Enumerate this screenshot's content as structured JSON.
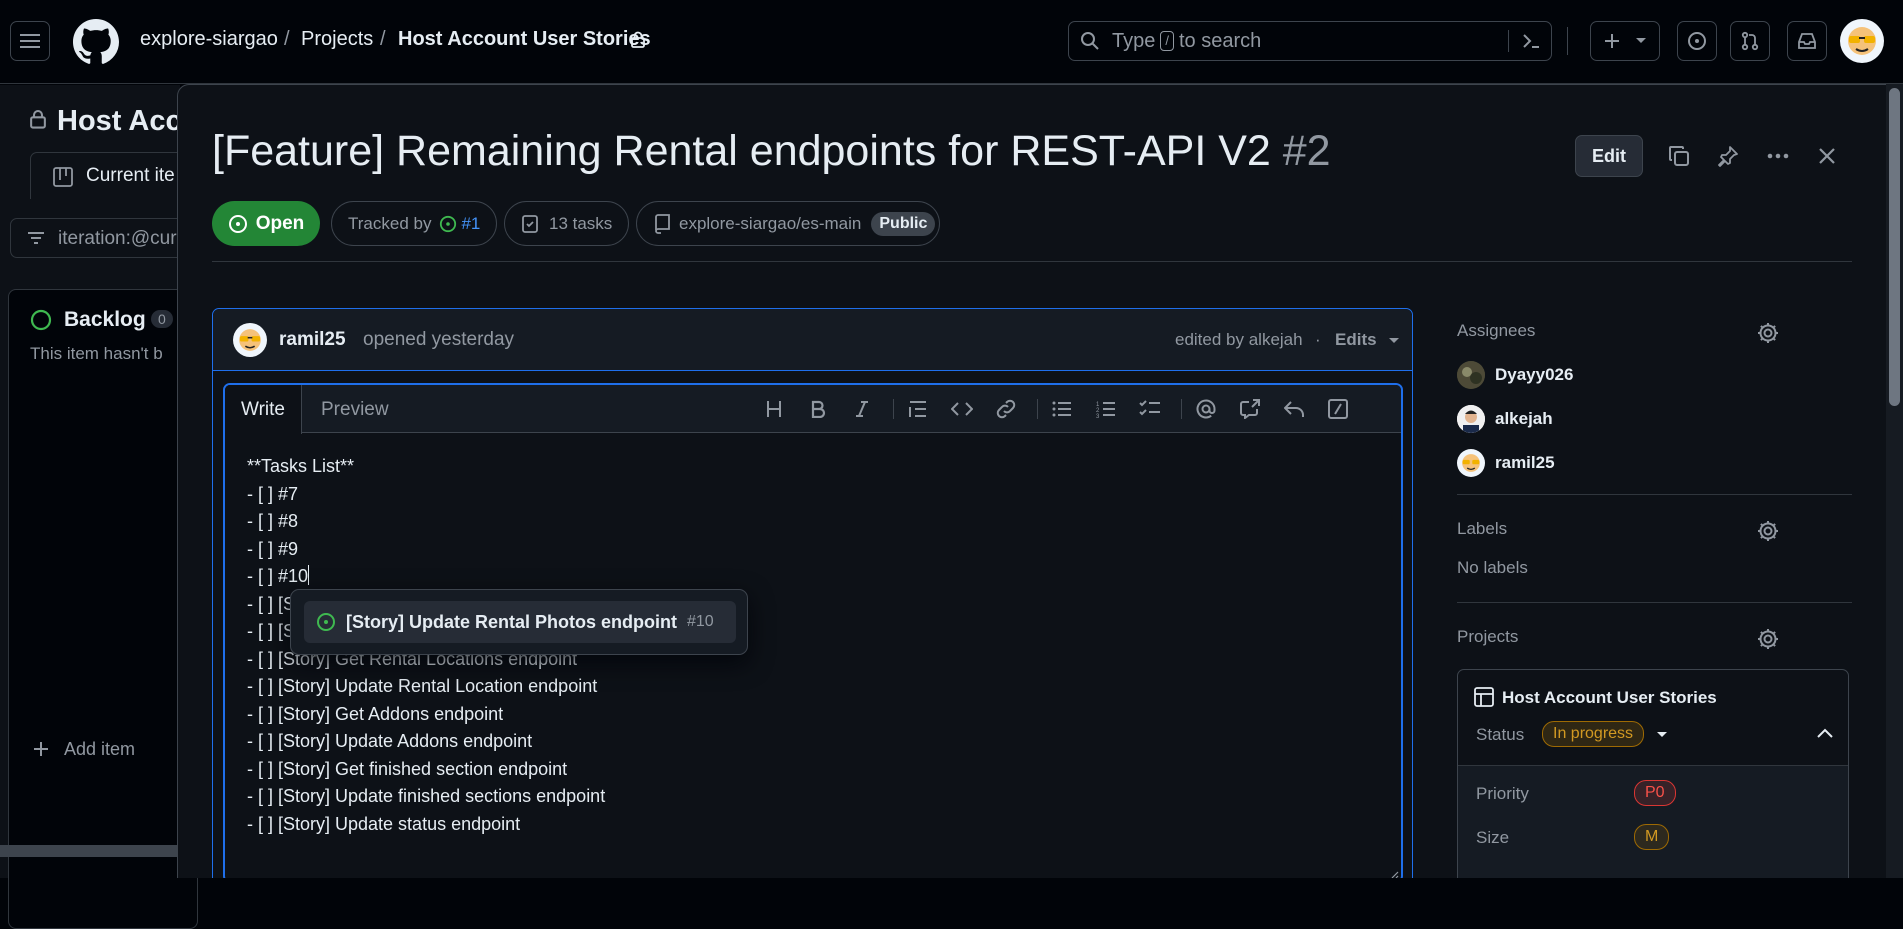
{
  "header": {
    "org": "explore-siargao",
    "projects": "Projects",
    "project": "Host Account User Stories",
    "search_text": "Type",
    "search_key": "/",
    "search_suffix": "to search"
  },
  "background": {
    "title": "Host Acco",
    "tab": "Current ite",
    "filter": "iteration:@cur",
    "column_title": "Backlog",
    "column_count": "0",
    "column_empty": "This item hasn't b",
    "add_item": "Add item"
  },
  "issue": {
    "title": "[Feature] Remaining Rental endpoints for REST-API V2",
    "number": "#2",
    "edit_label": "Edit",
    "state": "Open",
    "tracked_by_label": "Tracked by",
    "tracked_by_ref": "#1",
    "tasks": "13 tasks",
    "repo": "explore-siargao/es-main",
    "visibility": "Public"
  },
  "comment": {
    "author": "ramil25",
    "action": "opened yesterday",
    "edited_by": "edited by alkejah",
    "dot": "·",
    "edits_label": "Edits"
  },
  "editor": {
    "tab_write": "Write",
    "tab_preview": "Preview",
    "lines": [
      "**Tasks List**",
      "- [ ] #7",
      "- [ ] #8",
      "- [ ] #9",
      "- [ ] #10",
      "- [ ] [S",
      "- [ ] [S",
      "- [ ] [Story] Get Rental Locations endpoint",
      "- [ ] [Story] Update Rental Location endpoint",
      "- [ ] [Story] Get Addons endpoint",
      "- [ ] [Story] Update Addons endpoint",
      "- [ ] [Story] Get finished section endpoint",
      "- [ ] [Story] Update finished sections endpoint",
      "- [ ] [Story] Update status endpoint"
    ]
  },
  "suggestion": {
    "title": "[Story] Update Rental Photos endpoint",
    "number": "#10"
  },
  "sidebar": {
    "assignees_label": "Assignees",
    "assignees": [
      "Dyayy026",
      "alkejah",
      "ramil25"
    ],
    "labels_label": "Labels",
    "labels_value": "No labels",
    "projects_label": "Projects",
    "project_name": "Host Account User Stories",
    "status_label": "Status",
    "status_value": "In progress",
    "priority_label": "Priority",
    "priority_value": "P0",
    "size_label": "Size",
    "size_value": "M"
  },
  "colors": {
    "accent": "#1f6feb",
    "open_green": "#238636",
    "status_yellow": "#d29922",
    "priority_red": "#f85149"
  }
}
